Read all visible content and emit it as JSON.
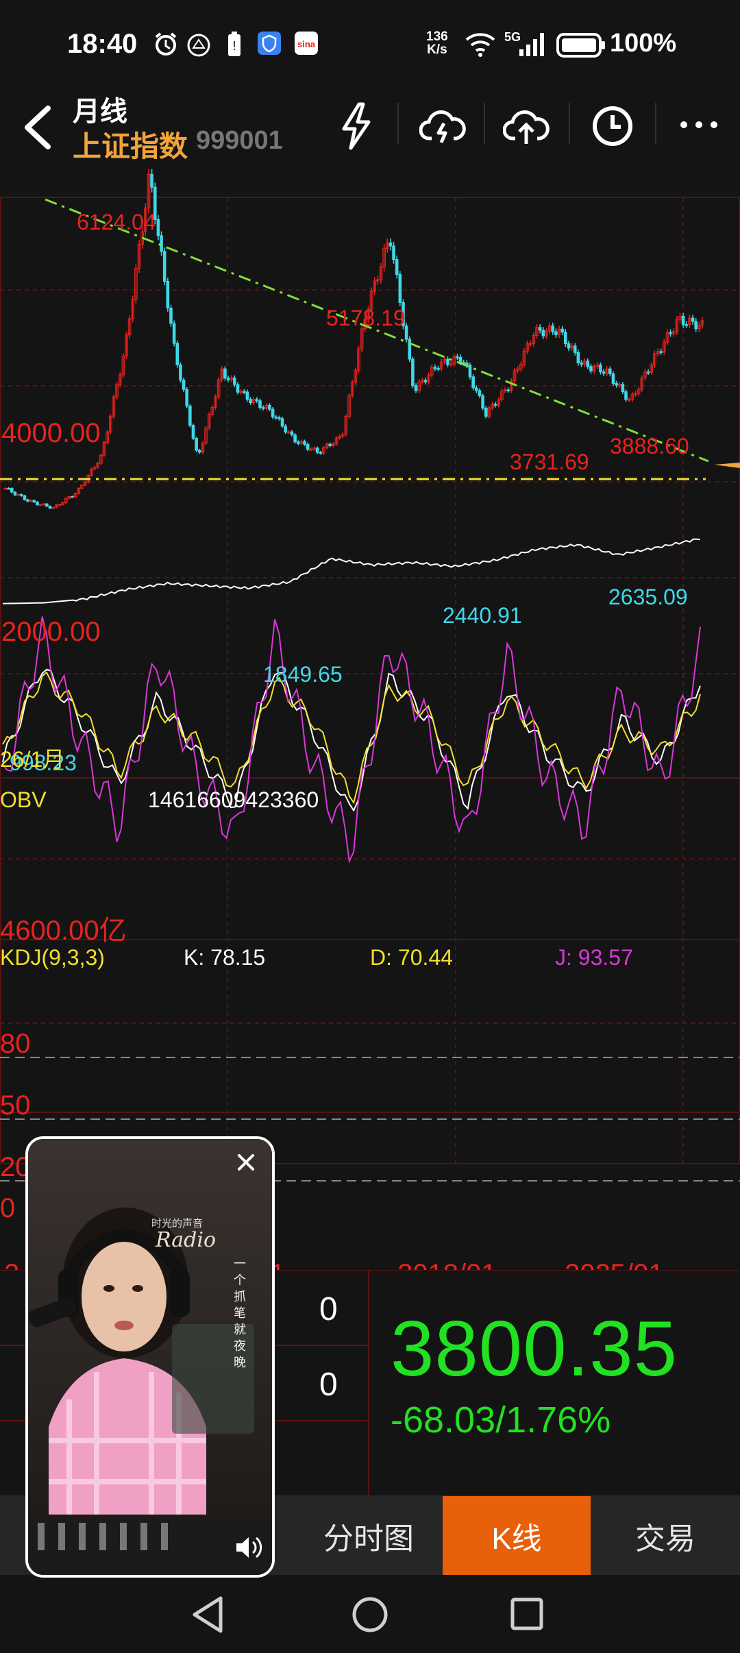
{
  "status_bar": {
    "time": "18:40",
    "net_speed_top": "136",
    "net_speed_bottom": "K/s",
    "network": "5G",
    "battery": "100%"
  },
  "header": {
    "period": "月线",
    "index_name": "上证指数",
    "index_code": "999001"
  },
  "main_chart": {
    "labels": {
      "high_6124": "6124.04",
      "high_5178": "5178.19",
      "high_3731": "3731.69",
      "high_3888": "3888.60",
      "low_1849": "1849.65",
      "low_2440": "2440.91",
      "low_2635": "2635.09",
      "low_998": "998.23",
      "axis_4000": "4000.00",
      "axis_2000": "2000.00",
      "start_tag": "26/1月"
    }
  },
  "obv": {
    "name": "OBV",
    "value": "14616609423360",
    "axis_label": "4600.00亿"
  },
  "kdj": {
    "name": "KDJ(9,3,3)",
    "k": "K: 78.15",
    "d": "D: 70.44",
    "j": "J: 93.57",
    "levels": [
      "80",
      "50",
      "20",
      "0"
    ]
  },
  "x_axis": {
    "labels": [
      "2",
      "1",
      "2018/01",
      "2025/01"
    ]
  },
  "quote": {
    "vol_a": "0",
    "vol_b": "0",
    "price": "3800.35",
    "change": "-68.03/1.76%"
  },
  "tabs": [
    "分时图",
    "K线",
    "交易"
  ],
  "video": {
    "brand": "Radio",
    "line1": "时光的声音",
    "vertical": "一个抓笔就夜晚"
  },
  "colors": {
    "up": "#e8231f",
    "down": "#40d8e8",
    "price": "#22e022",
    "active_tab": "#e8600a"
  },
  "chart_data": [
    {
      "type": "line",
      "title": "上证指数 月线",
      "series": [
        {
          "name": "上证指数",
          "values": [
            1300,
            1100,
            998.23,
            1250,
            1800,
            3500,
            6124.04,
            3500,
            1750,
            3100,
            2700,
            2500,
            2050,
            1849.65,
            2100,
            4000,
            5178.19,
            2800,
            3200,
            3300,
            2440.91,
            2900,
            3700,
            3731.69,
            3200,
            3100,
            2635.09,
            3300,
            3888.6,
            3800.35
          ]
        }
      ],
      "annotations": [
        "6124.04",
        "5178.19",
        "3731.69",
        "3888.60",
        "1849.65",
        "2440.91",
        "2635.09",
        "998.23"
      ]
    },
    {
      "type": "line",
      "title": "OBV",
      "series": [
        {
          "name": "OBV",
          "values": [
            0.02,
            0.03,
            0.08,
            0.2,
            0.28,
            0.25,
            0.22,
            0.3,
            0.6,
            0.52,
            0.55,
            0.5,
            0.58,
            0.72,
            0.78,
            0.65,
            0.75,
            0.86
          ]
        }
      ]
    },
    {
      "type": "line",
      "title": "KDJ(9,3,3)",
      "series": [
        {
          "name": "K",
          "values": [
            40,
            85,
            60,
            30,
            70,
            45,
            20,
            85,
            55,
            15,
            80,
            60,
            20,
            75,
            45,
            25,
            60,
            40,
            78.15
          ]
        },
        {
          "name": "D",
          "values": [
            45,
            80,
            65,
            35,
            65,
            50,
            28,
            78,
            60,
            22,
            75,
            62,
            28,
            70,
            50,
            30,
            55,
            45,
            70.44
          ]
        },
        {
          "name": "J",
          "values": [
            30,
            100,
            50,
            10,
            90,
            35,
            5,
            100,
            40,
            0,
            95,
            55,
            5,
            90,
            35,
            10,
            75,
            30,
            93.57
          ]
        }
      ]
    }
  ]
}
